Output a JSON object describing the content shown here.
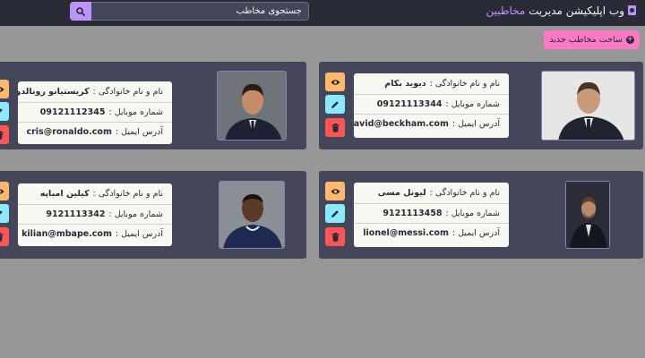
{
  "navbar": {
    "brand_prefix": "وب اپلیکیشن مدیریت",
    "brand_accent": "مخاطبین",
    "icon": "address-book-icon"
  },
  "search": {
    "placeholder": "جستجوی مخاطب",
    "icon": "search-icon"
  },
  "add_button": {
    "label": "ساخت مخاطب جدید",
    "icon": "plus-circle-icon"
  },
  "labels": {
    "name": "نام و نام خانوادگی :",
    "phone": "شماره موبایل :",
    "email": "آدرس ایمیل :"
  },
  "contacts": [
    {
      "name": "دیوید بکام",
      "phone": "09121113344",
      "email": "david@beckham.com"
    },
    {
      "name": "کریستیانو رونالدو",
      "phone": "09121112345",
      "email": "cris@ronaldo.com"
    },
    {
      "name": "لیونل مسی",
      "phone": "9121113458",
      "email": "lionel@messi.com"
    },
    {
      "name": "کیلین امباپه",
      "phone": "9121113342",
      "email": "kilian@mbape.com"
    }
  ],
  "action_icons": {
    "view": "eye-icon",
    "edit": "pen-icon",
    "delete": "trash-icon"
  },
  "colors": {
    "background": "#979797",
    "navbar": "#282a36",
    "card": "#44475a",
    "info_box": "#f8f8f2",
    "purple": "#bd93f9",
    "pink": "#ff79c6",
    "orange": "#ffb86c",
    "cyan": "#8be9fd",
    "red": "#ff5555"
  }
}
